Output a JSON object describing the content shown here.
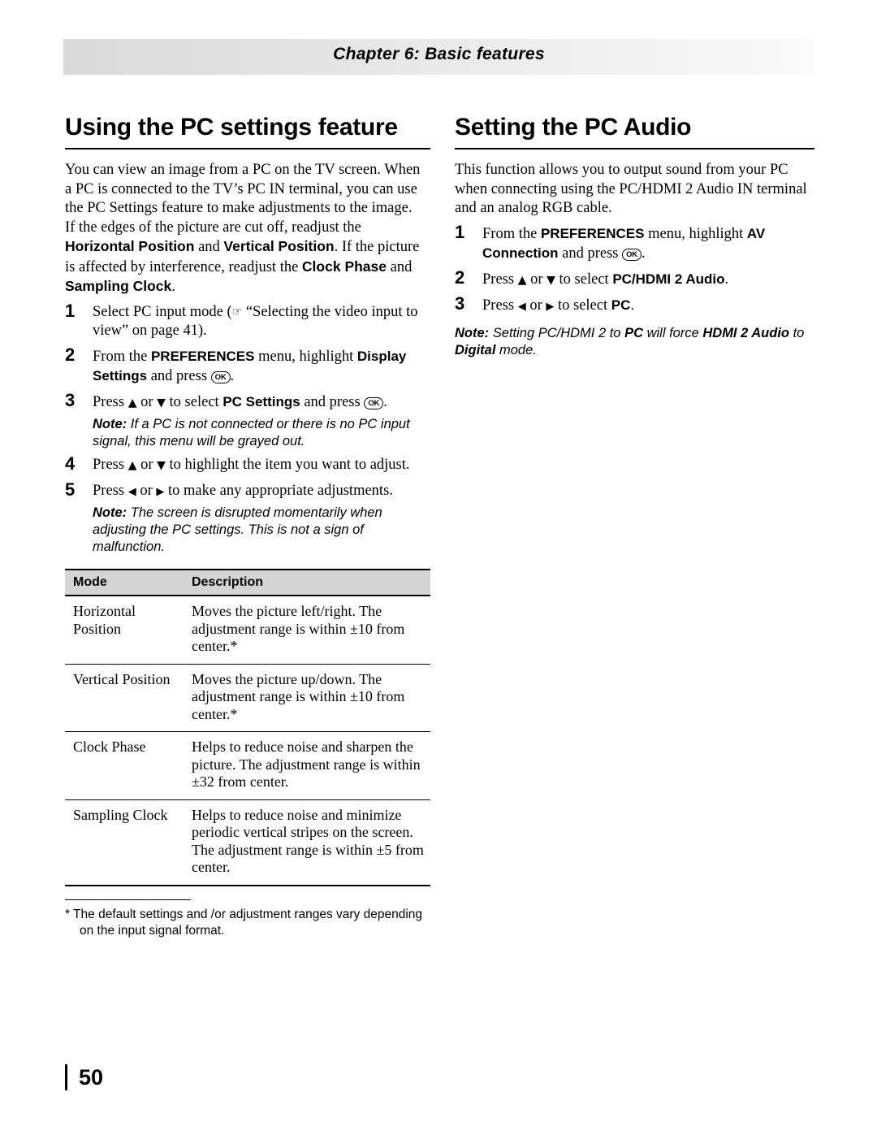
{
  "header": {
    "chapter": "Chapter 6: Basic features"
  },
  "left": {
    "title": "Using the PC settings feature",
    "intro1": "You can view an image from a PC on the TV screen. When a PC is connected to the TV’s PC IN terminal, you can use the PC Settings feature to make adjustments to the image.",
    "intro2_a": "If the edges of the picture are cut off, readjust the ",
    "intro2_b": "Horizontal Position",
    "intro2_c": " and ",
    "intro2_d": "Vertical Position",
    "intro2_e": ". If the picture is affected by interference, readjust the ",
    "intro2_f": "Clock Phase",
    "intro2_g": " and ",
    "intro2_h": "Sampling Clock",
    "intro2_i": ".",
    "steps": [
      {
        "num": "1",
        "a": "Select PC input mode (",
        "b": "“Selecting the video input to view” on page 41).",
        "bold": ""
      },
      {
        "num": "2",
        "a": "From the ",
        "bold1": "PREFERENCES",
        "b": " menu, highlight ",
        "bold2": "Display Settings",
        "c": " and press ",
        "ok": "OK",
        "d": "."
      },
      {
        "num": "3",
        "a": "Press ",
        "up": "▲",
        "b": " or ",
        "down": "▼",
        "c": " to select ",
        "bold1": "PC Settings",
        "d": " and press ",
        "ok": "OK",
        "e": "."
      },
      {
        "num": "4",
        "a": "Press ",
        "up": "▲",
        "b": " or ",
        "down": "▼",
        "c": " to highlight the item you want to adjust."
      },
      {
        "num": "5",
        "a": "Press ",
        "left": "◀",
        "b": " or ",
        "right": "▶",
        "c": " to make any appropriate adjustments."
      }
    ],
    "note1_label": "Note:",
    "note1_text": " If a PC is not connected or there is no PC input signal, this menu will be grayed out.",
    "note2_label": "Note:",
    "note2_text": " The screen is disrupted momentarily when adjusting the PC settings. This is not a sign of malfunction.",
    "table": {
      "headers": [
        "Mode",
        "Description"
      ],
      "rows": [
        {
          "mode": "Horizontal Position",
          "description": "Moves the picture left/right. The adjustment range is within ±10 from center.*"
        },
        {
          "mode": "Vertical Position",
          "description": "Moves the picture up/down. The adjustment range is within ±10 from center.*"
        },
        {
          "mode": "Clock Phase",
          "description": "Helps to reduce noise and sharpen the picture. The adjustment range is within ±32 from center."
        },
        {
          "mode": "Sampling Clock",
          "description": "Helps to reduce noise and minimize periodic vertical stripes on the screen. The adjustment range is within ±5 from center."
        }
      ]
    },
    "footnote": "* The default settings and /or adjustment ranges vary depending on the input signal format."
  },
  "right": {
    "title": "Setting the PC Audio",
    "intro": "This function allows you to output sound from your PC when connecting using the PC/HDMI 2 Audio IN terminal and an analog RGB cable.",
    "steps": [
      {
        "num": "1",
        "a": "From the ",
        "bold1": "PREFERENCES",
        "b": " menu, highlight ",
        "bold2": "AV Connection",
        "c": " and press ",
        "ok": "OK",
        "d": "."
      },
      {
        "num": "2",
        "a": "Press ",
        "up": "▲",
        "b": " or ",
        "down": "▼",
        "c": " to select ",
        "bold1": "PC/HDMI 2 Audio",
        "d": "."
      },
      {
        "num": "3",
        "a": "Press ",
        "left": "◀",
        "b": " or ",
        "right": "▶",
        "c": " to select ",
        "bold1": "PC",
        "d": "."
      }
    ],
    "note_label": "Note:",
    "note_a": " Setting PC/HDMI 2 to ",
    "note_b": "PC",
    "note_c": " will force ",
    "note_d": "HDMI 2 Audio",
    "note_e": " to ",
    "note_f": "Digital",
    "note_g": " mode."
  },
  "footer": {
    "page_number": "50"
  }
}
